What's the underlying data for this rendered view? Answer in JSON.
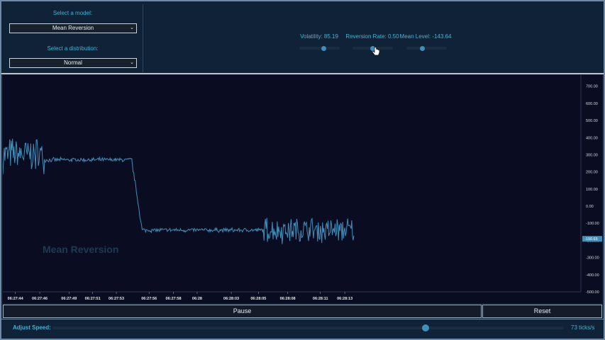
{
  "model_select": {
    "label": "Select a model:",
    "value": "Mean Reversion"
  },
  "distribution_select": {
    "label": "Select a distribution:",
    "value": "Normal"
  },
  "sliders": [
    {
      "label": "Volatility: 85.19",
      "level": 0.6
    },
    {
      "label": "Reversion Rate: 0.50",
      "level": 0.5
    },
    {
      "label": "Mean Level: -143.64",
      "level": 0.4
    }
  ],
  "watermark": "Mean Reversion",
  "buttons": {
    "pause": "Pause",
    "reset": "Reset"
  },
  "speed": {
    "label": "Adjust Speed:",
    "value": "73 ticks/s",
    "level": 0.74
  },
  "colors": {
    "line": "#3f8fb9",
    "accent": "#3fb6d3",
    "background": "#0a0d22",
    "current_value_badge": "#3f8fb9"
  },
  "chart_data": {
    "type": "line",
    "series": [
      {
        "name": "",
        "values": []
      }
    ],
    "segments": [
      {
        "from_tick": 0,
        "to_tick": 60,
        "mean": 300,
        "noise": 120
      },
      {
        "from_tick": 60,
        "to_tick": 185,
        "mean": 270,
        "noise": 15
      },
      {
        "from_tick": 185,
        "to_tick": 200,
        "mean": 100,
        "noise": 20
      },
      {
        "from_tick": 200,
        "to_tick": 375,
        "mean": -140,
        "noise": 15
      },
      {
        "from_tick": 375,
        "to_tick": 505,
        "mean": -140,
        "noise": 90
      }
    ],
    "current_value": "-190.65",
    "yticks": [
      "700.00",
      "600.00",
      "500.00",
      "400.00",
      "300.00",
      "200.00",
      "100.00",
      "0.00",
      "-100.00",
      "-200.00",
      "-300.00",
      "-400.00",
      "-500.00"
    ],
    "ylim": [
      -500,
      740
    ],
    "xticks": [
      "06:27:44",
      "06:27:46",
      "06:27:49",
      "06:27:51",
      "06:27:53",
      "06:27:56",
      "06:27:58",
      "06:28",
      "06:28:03",
      "06:28:05",
      "06:28:08",
      "06:28:11",
      "06:28:13"
    ],
    "xtick_at_tick": [
      18,
      53,
      95,
      129,
      163,
      210,
      245,
      279,
      328,
      367,
      409,
      456,
      491
    ],
    "total_ticks": 830
  }
}
